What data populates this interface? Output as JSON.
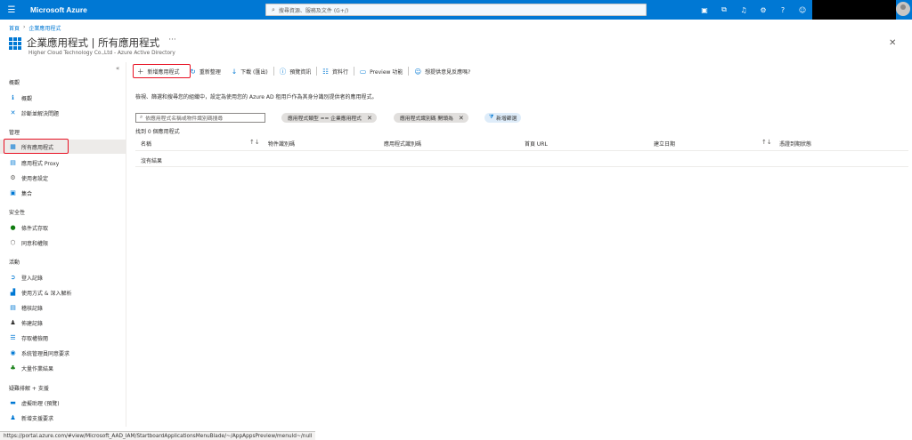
{
  "topbar": {
    "brand": "Microsoft Azure",
    "search_placeholder": "搜尋資源、服務及文件 (G+/)",
    "icons": [
      "cloud-shell-icon",
      "directory-filter-icon",
      "notification-bell-icon",
      "settings-gear-icon",
      "help-icon",
      "feedback-icon"
    ]
  },
  "breadcrumb": {
    "home": "首頁",
    "current": "企業應用程式"
  },
  "header": {
    "title": "企業應用程式 | 所有應用程式",
    "more": "···",
    "subtitle": "Higher Cloud Technology Co.,Ltd - Azure Active Directory"
  },
  "sidebar": {
    "sections": {
      "overview": "概觀",
      "manage": "管理",
      "security": "安全性",
      "activity": "活動",
      "troubleshoot": "疑難排解 + 支援"
    },
    "items": {
      "overview": "概觀",
      "diagnose": "診斷並解決問題",
      "all_apps": "所有應用程式",
      "app_proxy": "應用程式 Proxy",
      "user_settings": "使用者設定",
      "collections": "集合",
      "conditional_access": "條件式存取",
      "consent": "同意和權限",
      "signin_logs": "登入記錄",
      "usage_insights": "使用方式 & 深入解析",
      "audit_logs": "稽核記錄",
      "provisioning_logs": "佈建記錄",
      "access_reviews": "存取權檢閱",
      "admin_consent": "系統管理員同意要求",
      "bulk_results": "大量作業結果",
      "virtual_assistant": "虛擬助理 (預覽)",
      "new_support": "新增支援要求"
    }
  },
  "toolbar": {
    "new_app": "新增應用程式",
    "refresh": "重新整理",
    "download": "下載 (匯出)",
    "preview_info": "預覽資訊",
    "columns": "資料行",
    "preview_features": "Preview 功能",
    "feedback": "想提供意見反應嗎?"
  },
  "main": {
    "description": "檢視、篩選和搜尋您的組織中，設定為使用您的 Azure AD 租用戶作為其身分識別提供者的應用程式。",
    "filter_placeholder": "依應用程式名稱或物件識別碼搜尋",
    "filter_pills": [
      "應用程式類型 == 企業應用程式",
      "應用程式識別碼 開頭為"
    ],
    "add_filter": "新增篩選",
    "found": "找到 0 個應用程式",
    "columns": [
      "名稱",
      "物件識別碼",
      "應用程式識別碼",
      "首頁 URL",
      "建立日期",
      "憑證到期狀態"
    ],
    "empty": "沒有結果"
  },
  "statusbar": {
    "url": "https://portal.azure.com/#view/Microsoft_AAD_IAM/StartboardApplicationsMenuBlade/~/AppAppsPreview/menuId~/null"
  },
  "colors": {
    "accent": "#0078d4",
    "highlight": "#e81123"
  }
}
